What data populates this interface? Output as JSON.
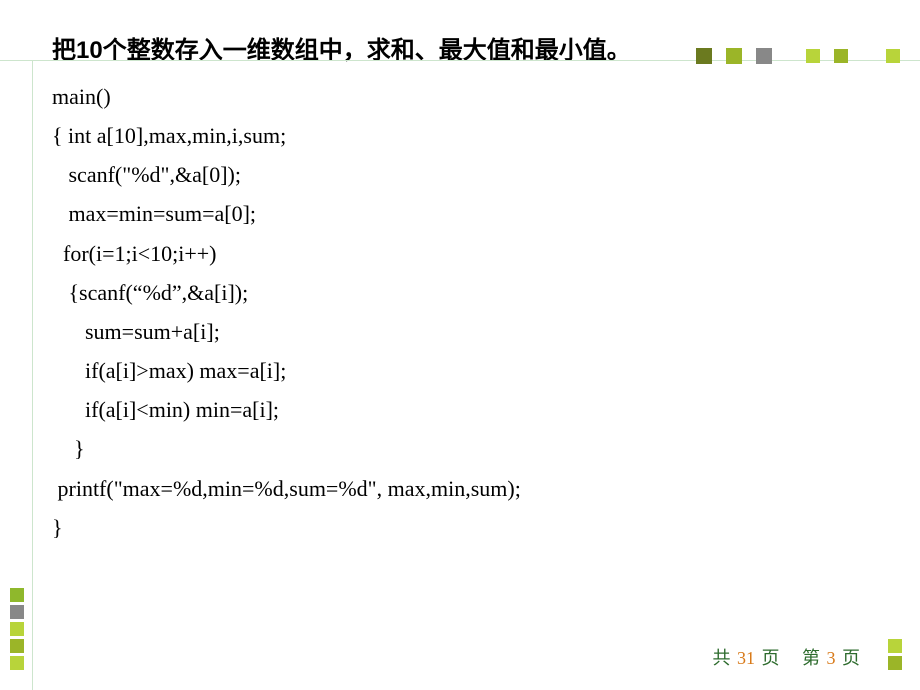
{
  "title": "把10个整数存入一维数组中，求和、最大值和最小值。",
  "code": {
    "l1": "main()",
    "l2": "{ int a[10],max,min,i,sum;",
    "l3": "   scanf(\"%d\",&a[0]);",
    "l4": "   max=min=sum=a[0];",
    "l5": "  for(i=1;i<10;i++)",
    "l6": "   {scanf(“%d”,&a[i]);",
    "l7": "      sum=sum+a[i];",
    "l8": "      if(a[i]>max) max=a[i];",
    "l9": "      if(a[i]<min) min=a[i];",
    "l10": "    }",
    "l11": " printf(\"max=%d,min=%d,sum=%d\", max,min,sum);",
    "l12": "}"
  },
  "footer": {
    "gong": "共",
    "total": "31",
    "ye1": "页",
    "di": "第",
    "current": "3",
    "ye2": "页"
  }
}
